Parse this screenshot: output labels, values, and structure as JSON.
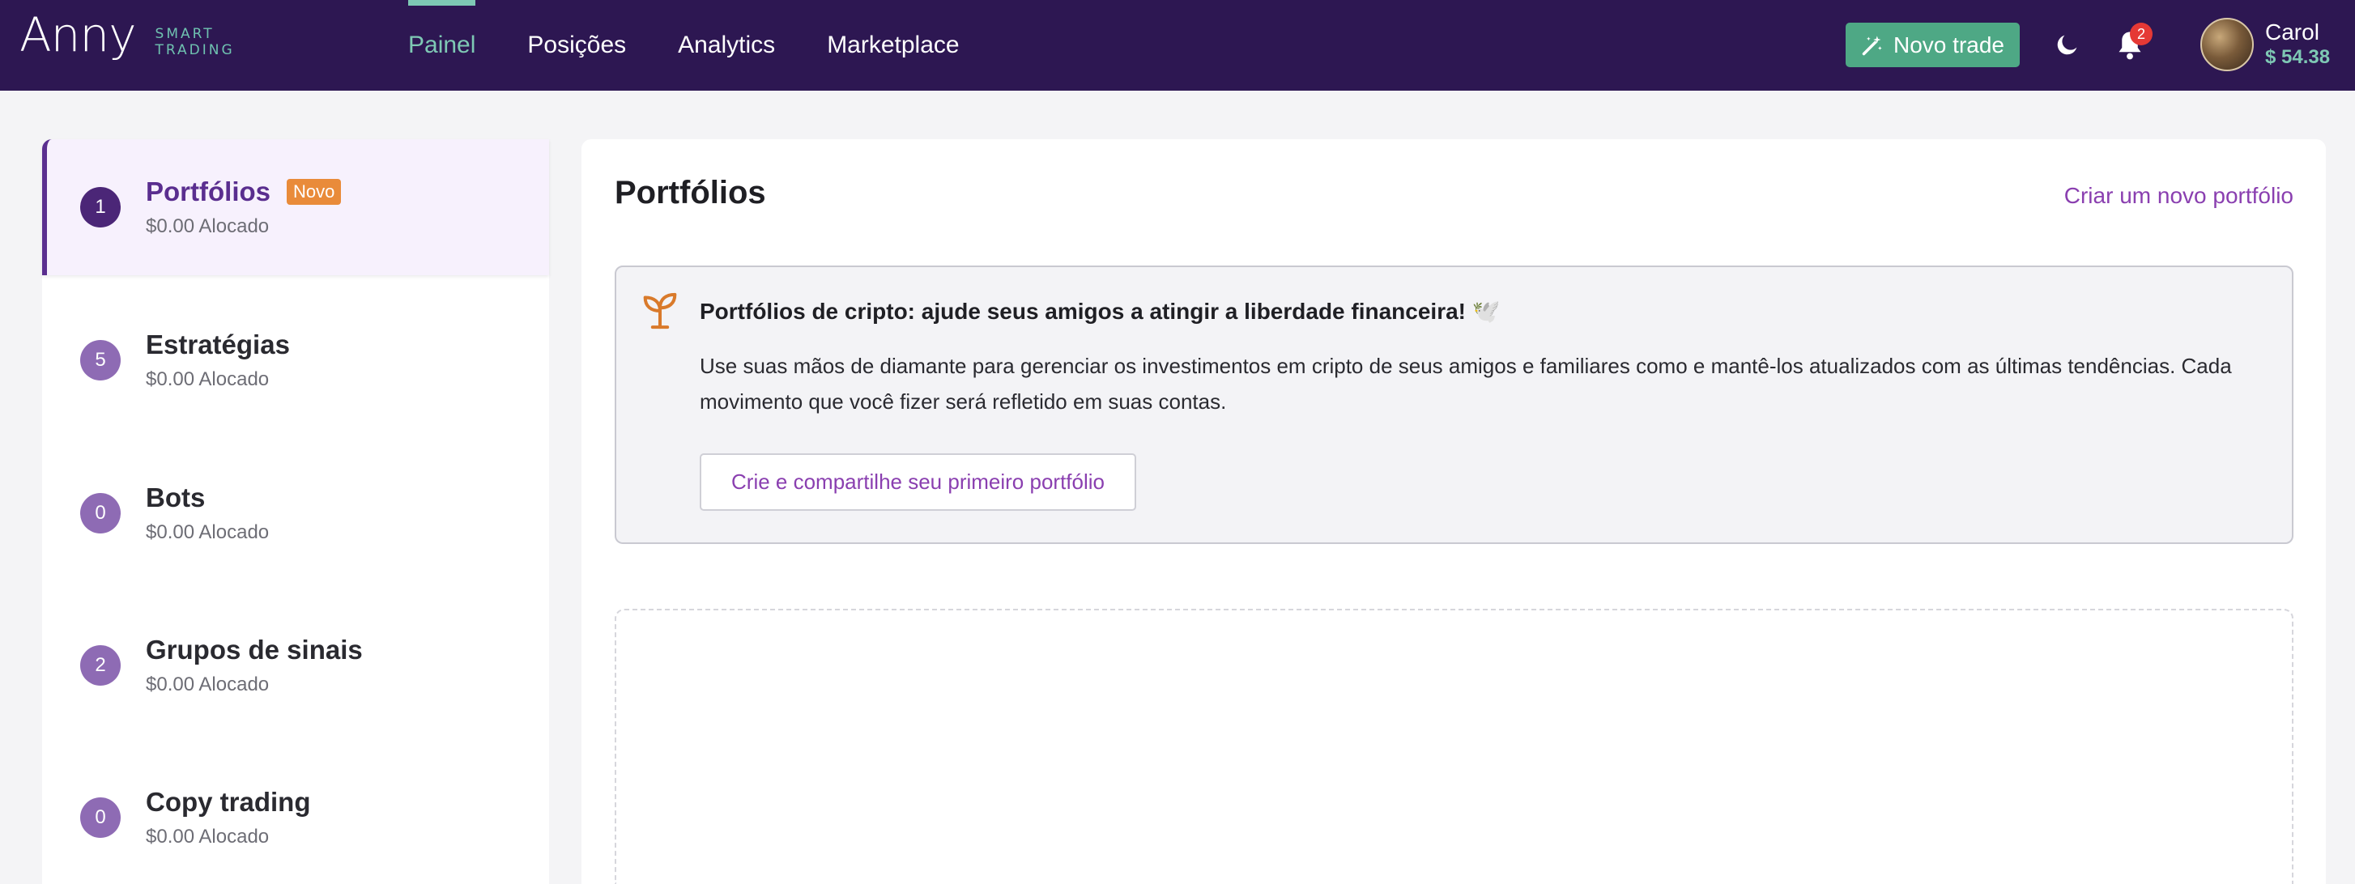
{
  "header": {
    "logo_text": "Anny",
    "logo_sub_line1": "SMART",
    "logo_sub_line2": "TRADING",
    "nav": [
      {
        "label": "Painel",
        "active": true
      },
      {
        "label": "Posições",
        "active": false
      },
      {
        "label": "Analytics",
        "active": false
      },
      {
        "label": "Marketplace",
        "active": false
      }
    ],
    "new_trade_label": "Novo trade",
    "notification_count": "2",
    "user": {
      "name": "Carol",
      "balance": "$ 54.38"
    }
  },
  "sidebar": {
    "items": [
      {
        "count": "1",
        "title": "Portfólios",
        "badge": "Novo",
        "subtitle": "$0.00 Alocado",
        "active": true
      },
      {
        "count": "5",
        "title": "Estratégias",
        "subtitle": "$0.00 Alocado",
        "active": false
      },
      {
        "count": "0",
        "title": "Bots",
        "subtitle": "$0.00 Alocado",
        "active": false
      },
      {
        "count": "2",
        "title": "Grupos de sinais",
        "subtitle": "$0.00 Alocado",
        "active": false
      },
      {
        "count": "0",
        "title": "Copy trading",
        "subtitle": "$0.00 Alocado",
        "active": false
      }
    ]
  },
  "main": {
    "title": "Portfólios",
    "create_link": "Criar um novo portfólio",
    "promo": {
      "title": "Portfólios de cripto: ajude seus amigos a atingir a liberdade financeira! 🕊️",
      "body": "Use suas mãos de diamante para gerenciar os investimentos em cripto de seus amigos e familiares como e mantê-los atualizados com as últimas tendências. Cada movimento que você fizer será refletido em suas contas.",
      "button": "Crie e compartilhe seu primeiro portfólio"
    }
  },
  "colors": {
    "navbar_bg": "#2d1752",
    "accent_green": "#4ea885",
    "nav_active": "#7ec8b4",
    "primary_purple": "#5a2e8f",
    "link_purple": "#8a3fb0",
    "badge_orange": "#e98b3a",
    "notif_red": "#e53935"
  },
  "icons": {
    "new_trade": "magic-wand-icon",
    "theme": "moon-icon",
    "notifications": "bell-icon",
    "promo": "sprout-icon"
  }
}
